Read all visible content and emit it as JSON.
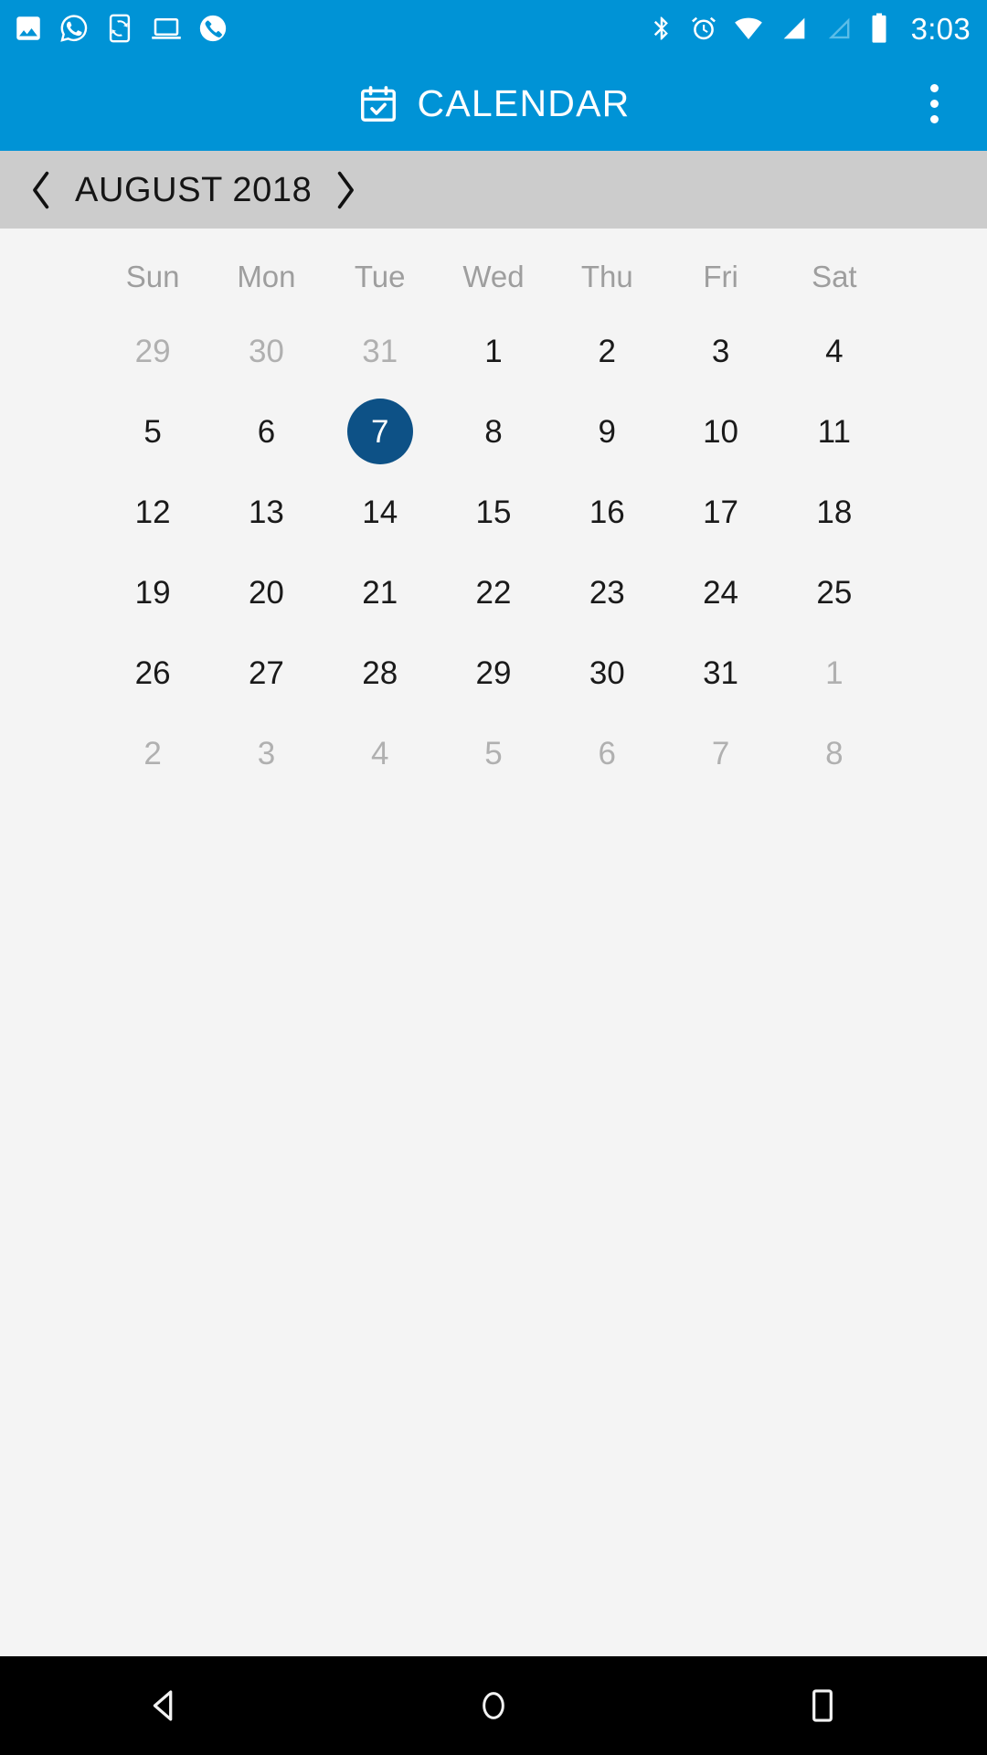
{
  "status_bar": {
    "background_color": "#0093d6",
    "time": "3:03",
    "left_icons": [
      {
        "name": "image-icon",
        "label": "Gallery"
      },
      {
        "name": "whatsapp-icon",
        "label": "WhatsApp"
      },
      {
        "name": "phone-sync-icon",
        "label": "Phone sync"
      },
      {
        "name": "laptop-icon",
        "label": "Laptop connected"
      },
      {
        "name": "call-icon",
        "label": "Phone call"
      }
    ],
    "right_icons": [
      {
        "name": "bluetooth-icon",
        "label": "Bluetooth"
      },
      {
        "name": "alarm-icon",
        "label": "Alarm set"
      },
      {
        "name": "wifi-icon",
        "label": "Wi-Fi"
      },
      {
        "name": "signal-icon",
        "label": "Cellular signal"
      },
      {
        "name": "signal-empty-icon",
        "label": "Second SIM no signal"
      },
      {
        "name": "battery-icon",
        "label": "Battery full"
      }
    ]
  },
  "app_bar": {
    "background_color": "#0093d6",
    "title": "CALENDAR",
    "icon": "calendar-check-icon",
    "overflow_menu": "more-options"
  },
  "month_bar": {
    "background_color": "#cccccc",
    "label": "AUGUST 2018",
    "prev_icon": "chevron-left-icon",
    "next_icon": "chevron-right-icon"
  },
  "calendar": {
    "background_color": "#f4f4f4",
    "selected_color": "#0d5186",
    "muted_color": "#b0b0b0",
    "day_color": "#1a1a1a",
    "day_headers": [
      "Sun",
      "Mon",
      "Tue",
      "Wed",
      "Thu",
      "Fri",
      "Sat"
    ],
    "selected_day": 7,
    "weeks": [
      [
        {
          "n": "29",
          "muted": true,
          "selected": false
        },
        {
          "n": "30",
          "muted": true,
          "selected": false
        },
        {
          "n": "31",
          "muted": true,
          "selected": false
        },
        {
          "n": "1",
          "muted": false,
          "selected": false
        },
        {
          "n": "2",
          "muted": false,
          "selected": false
        },
        {
          "n": "3",
          "muted": false,
          "selected": false
        },
        {
          "n": "4",
          "muted": false,
          "selected": false
        }
      ],
      [
        {
          "n": "5",
          "muted": false,
          "selected": false
        },
        {
          "n": "6",
          "muted": false,
          "selected": false
        },
        {
          "n": "7",
          "muted": false,
          "selected": true
        },
        {
          "n": "8",
          "muted": false,
          "selected": false
        },
        {
          "n": "9",
          "muted": false,
          "selected": false
        },
        {
          "n": "10",
          "muted": false,
          "selected": false
        },
        {
          "n": "11",
          "muted": false,
          "selected": false
        }
      ],
      [
        {
          "n": "12",
          "muted": false,
          "selected": false
        },
        {
          "n": "13",
          "muted": false,
          "selected": false
        },
        {
          "n": "14",
          "muted": false,
          "selected": false
        },
        {
          "n": "15",
          "muted": false,
          "selected": false
        },
        {
          "n": "16",
          "muted": false,
          "selected": false
        },
        {
          "n": "17",
          "muted": false,
          "selected": false
        },
        {
          "n": "18",
          "muted": false,
          "selected": false
        }
      ],
      [
        {
          "n": "19",
          "muted": false,
          "selected": false
        },
        {
          "n": "20",
          "muted": false,
          "selected": false
        },
        {
          "n": "21",
          "muted": false,
          "selected": false
        },
        {
          "n": "22",
          "muted": false,
          "selected": false
        },
        {
          "n": "23",
          "muted": false,
          "selected": false
        },
        {
          "n": "24",
          "muted": false,
          "selected": false
        },
        {
          "n": "25",
          "muted": false,
          "selected": false
        }
      ],
      [
        {
          "n": "26",
          "muted": false,
          "selected": false
        },
        {
          "n": "27",
          "muted": false,
          "selected": false
        },
        {
          "n": "28",
          "muted": false,
          "selected": false
        },
        {
          "n": "29",
          "muted": false,
          "selected": false
        },
        {
          "n": "30",
          "muted": false,
          "selected": false
        },
        {
          "n": "31",
          "muted": false,
          "selected": false
        },
        {
          "n": "1",
          "muted": true,
          "selected": false
        }
      ],
      [
        {
          "n": "2",
          "muted": true,
          "selected": false
        },
        {
          "n": "3",
          "muted": true,
          "selected": false
        },
        {
          "n": "4",
          "muted": true,
          "selected": false
        },
        {
          "n": "5",
          "muted": true,
          "selected": false
        },
        {
          "n": "6",
          "muted": true,
          "selected": false
        },
        {
          "n": "7",
          "muted": true,
          "selected": false
        },
        {
          "n": "8",
          "muted": true,
          "selected": false
        }
      ]
    ]
  },
  "nav_bar": {
    "background_color": "#000000",
    "buttons": [
      {
        "name": "back-button",
        "icon": "triangle-left-icon"
      },
      {
        "name": "home-button",
        "icon": "circle-icon"
      },
      {
        "name": "recents-button",
        "icon": "square-icon"
      }
    ]
  }
}
